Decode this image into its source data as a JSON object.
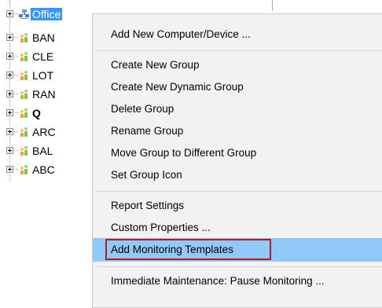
{
  "tree": {
    "items": [
      {
        "label": "Office",
        "selected": true,
        "icon": "network-group-icon"
      },
      {
        "label": "BAN",
        "icon": "group-icon"
      },
      {
        "label": "CLE",
        "icon": "group-icon"
      },
      {
        "label": "LOT",
        "icon": "group-icon"
      },
      {
        "label": "RAN",
        "icon": "group-icon"
      },
      {
        "label": "Q",
        "bold": true,
        "icon": "group-icon"
      },
      {
        "label": "ARC",
        "icon": "group-icon"
      },
      {
        "label": "BAL",
        "icon": "group-icon"
      },
      {
        "label": "ABC",
        "icon": "group-icon"
      }
    ]
  },
  "context_menu": {
    "items": [
      {
        "label": "Add New Computer/Device ..."
      },
      {
        "label": "Create New Group"
      },
      {
        "label": "Create New Dynamic Group"
      },
      {
        "label": "Delete Group"
      },
      {
        "label": "Rename Group"
      },
      {
        "label": "Move Group to Different Group"
      },
      {
        "label": "Set Group Icon"
      },
      {
        "label": "Report Settings"
      },
      {
        "label": "Custom Properties ..."
      },
      {
        "label": "Add Monitoring Templates",
        "highlighted": true
      },
      {
        "label": "Immediate Maintenance: Pause Monitoring ..."
      }
    ]
  },
  "colors": {
    "selection": "#3399ff",
    "menu_background": "#f2f2f2",
    "menu_highlight": "#91c9f7",
    "callout_border": "#b31b1b"
  }
}
